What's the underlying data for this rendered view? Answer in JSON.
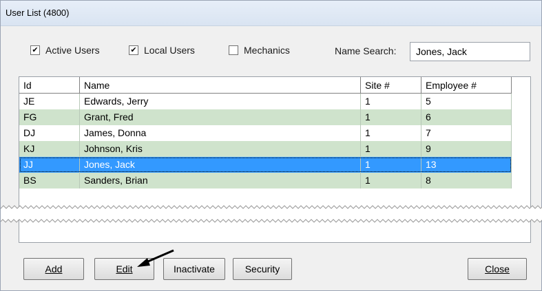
{
  "window": {
    "title": "User List (4800)"
  },
  "filters": {
    "active_users": {
      "label": "Active Users",
      "checked": true,
      "check": "✔"
    },
    "local_users": {
      "label": "Local Users",
      "checked": true,
      "check": "✔"
    },
    "mechanics": {
      "label": "Mechanics",
      "checked": false,
      "check": ""
    },
    "name_search_label": "Name Search:",
    "name_search_value": "Jones, Jack"
  },
  "table": {
    "columns": [
      "Id",
      "Name",
      "Site #",
      "Employee #"
    ],
    "rows": [
      {
        "id": "JE",
        "name": "Edwards, Jerry",
        "site": "1",
        "employee": "5",
        "style": "white"
      },
      {
        "id": "FG",
        "name": "Grant, Fred",
        "site": "1",
        "employee": "6",
        "style": "green"
      },
      {
        "id": "DJ",
        "name": "James, Donna",
        "site": "1",
        "employee": "7",
        "style": "white"
      },
      {
        "id": "KJ",
        "name": "Johnson, Kris",
        "site": "1",
        "employee": "9",
        "style": "green"
      },
      {
        "id": "JJ",
        "name": "Jones, Jack",
        "site": "1",
        "employee": "13",
        "style": "selected"
      },
      {
        "id": "BS",
        "name": "Sanders, Brian",
        "site": "1",
        "employee": "8",
        "style": "green"
      }
    ]
  },
  "buttons": {
    "add": "Add",
    "edit": "Edit",
    "inactivate": "Inactivate",
    "security": "Security",
    "close": "Close"
  },
  "colors": {
    "row_green": "#cfe3cc",
    "row_white": "#ffffff",
    "selected_bg": "#3399ff",
    "selected_border": "#1f5fbf"
  },
  "icons": {
    "pointer": "arrow-pointer-icon"
  }
}
